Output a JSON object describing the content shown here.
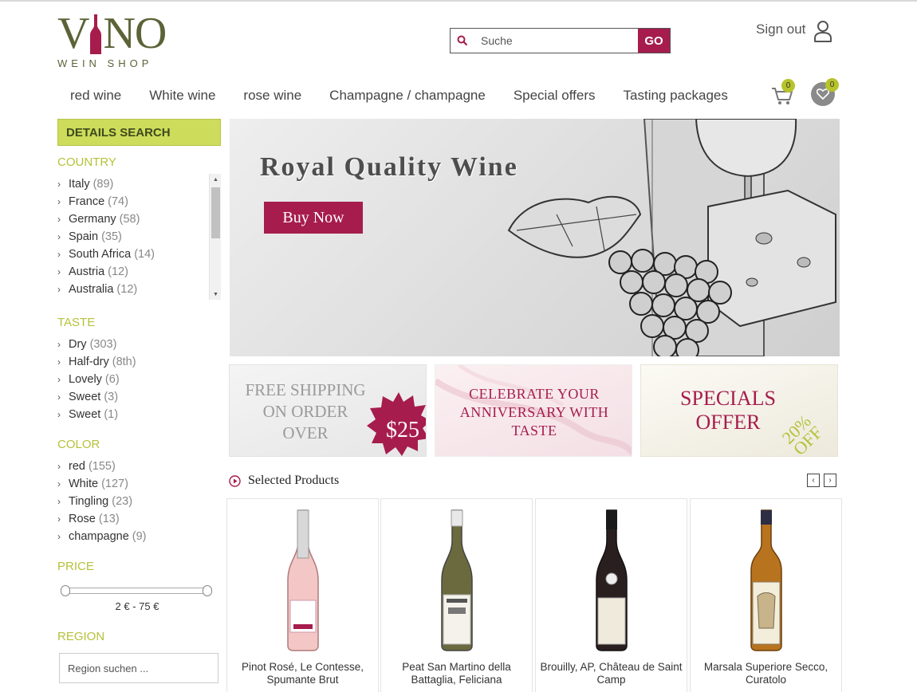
{
  "brand": {
    "name_start": "V",
    "name_end": "NO",
    "subtitle": "WEIN SHOP"
  },
  "search": {
    "placeholder": "Suche",
    "button_label": "GO"
  },
  "account": {
    "signout_label": "Sign out"
  },
  "nav": [
    "red wine",
    "White wine",
    "rose wine",
    "Champagne / champagne",
    "Special offers",
    "Tasting packages"
  ],
  "cart": {
    "count": "0"
  },
  "wishlist": {
    "count": "0"
  },
  "sidebar": {
    "title": "DETAILS SEARCH",
    "country": {
      "title": "COUNTRY",
      "items": [
        {
          "label": "Italy",
          "count": "(89)"
        },
        {
          "label": "France",
          "count": "(74)"
        },
        {
          "label": "Germany",
          "count": "(58)"
        },
        {
          "label": "Spain",
          "count": "(35)"
        },
        {
          "label": "South Africa",
          "count": "(14)"
        },
        {
          "label": "Austria",
          "count": "(12)"
        },
        {
          "label": "Australia",
          "count": "(12)"
        }
      ]
    },
    "taste": {
      "title": "TASTE",
      "items": [
        {
          "label": "Dry",
          "count": "(303)"
        },
        {
          "label": "Half-dry",
          "count": "(8th)"
        },
        {
          "label": "Lovely",
          "count": "(6)"
        },
        {
          "label": "Sweet",
          "count": "(3)"
        },
        {
          "label": "Sweet",
          "count": "(1)"
        }
      ]
    },
    "color": {
      "title": "COLOR",
      "items": [
        {
          "label": "red",
          "count": "(155)"
        },
        {
          "label": "White",
          "count": "(127)"
        },
        {
          "label": "Tingling",
          "count": "(23)"
        },
        {
          "label": "Rose",
          "count": "(13)"
        },
        {
          "label": "champagne",
          "count": "(9)"
        }
      ]
    },
    "price": {
      "title": "PRICE",
      "range_text": "2 € - 75 €"
    },
    "region": {
      "title": "REGION",
      "placeholder": "Region suchen ..."
    }
  },
  "hero": {
    "title": "Royal Quality Wine",
    "button_label": "Buy Now"
  },
  "promos": {
    "shipping": {
      "line1": "FREE SHIPPING",
      "line2": "ON ORDER",
      "line3": "OVER",
      "amount": "$25"
    },
    "anniversary": {
      "line1": "CELEBRATE YOUR",
      "line2": "ANNIVERSARY WITH",
      "line3": "TASTE"
    },
    "specials": {
      "line1": "SPECIALS",
      "line2": "OFFER",
      "percent": "20%",
      "off": "OFF"
    }
  },
  "selected": {
    "title": "Selected Products",
    "products": [
      {
        "name": "Pinot Rosé, Le Contesse, Spumante Brut"
      },
      {
        "name": "Peat San Martino della Battaglia, Feliciana"
      },
      {
        "name": "Brouilly, AP, Château de Saint Camp"
      },
      {
        "name": "Marsala Superiore Secco, Curatolo"
      }
    ]
  },
  "colors": {
    "accent": "#a61c4d",
    "brand_green": "#5b6337",
    "lime": "#cddc5b",
    "facet_title": "#b5c23a"
  }
}
